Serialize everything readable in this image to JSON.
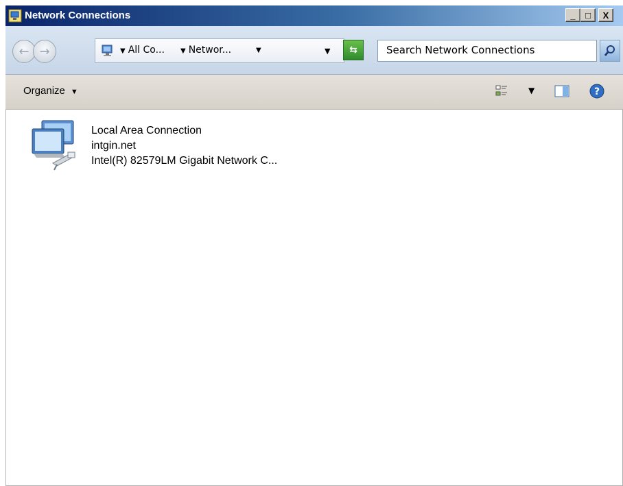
{
  "window": {
    "title": "Network Connections",
    "controls": {
      "minimize": "_",
      "maximize": "□",
      "close": "X"
    }
  },
  "address": {
    "crumbs": [
      "All Co...",
      "Networ..."
    ],
    "search_placeholder": "Search Network Connections"
  },
  "toolbar": {
    "organize_label": "Organize"
  },
  "items": [
    {
      "name": "Local Area Connection",
      "network": "intgin.net",
      "adapter": "Intel(R) 82579LM Gigabit Network C...",
      "icon": "network-adapter-icon"
    }
  ],
  "colors": {
    "titlebar_start": "#0a246a",
    "titlebar_end": "#a6caf0",
    "address_bg": "#c7d6e8",
    "command_bg": "#d6d1c9"
  }
}
